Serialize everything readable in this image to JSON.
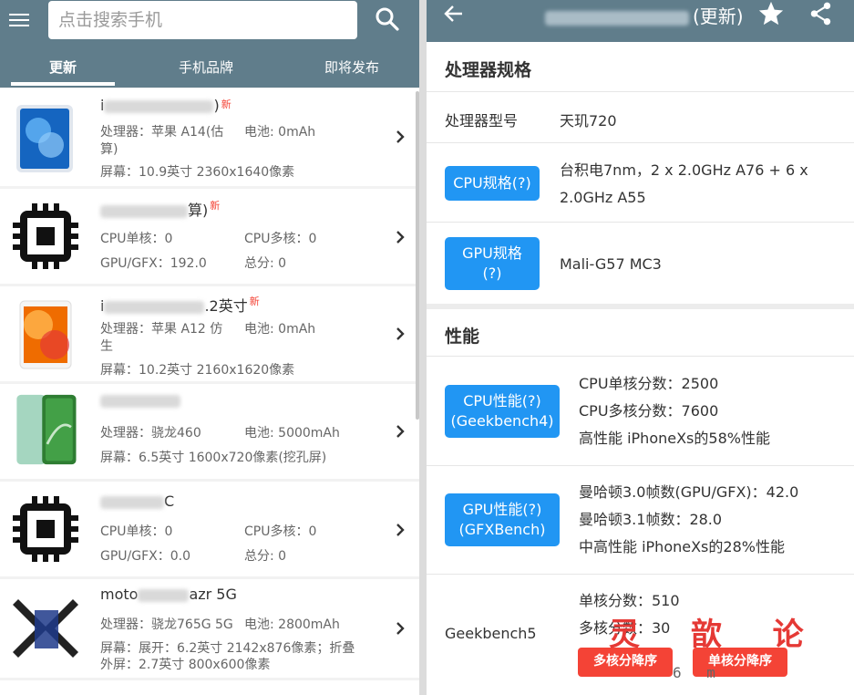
{
  "search": {
    "placeholder": "点击搜索手机"
  },
  "tabs": [
    {
      "label": "更新",
      "active": true
    },
    {
      "label": "手机品牌",
      "active": false
    },
    {
      "label": "即将发布",
      "active": false
    }
  ],
  "new_badge": "新",
  "devices": [
    {
      "name_prefix": "i",
      "name_suffix": ")",
      "new": true,
      "specs": [
        "处理器：苹果 A14(估",
        "电池: 0mAh",
        "算)",
        "屏幕：10.9英寸 2360x1640像素"
      ]
    },
    {
      "name_prefix": "",
      "name_suffix": "算)",
      "new": true,
      "specs": [
        "CPU单核：0",
        "CPU多核：0",
        "GPU/GFX：192.0",
        "总分: 0"
      ]
    },
    {
      "name_prefix": "i",
      "name_suffix": ".2英寸",
      "new": true,
      "specs": [
        "处理器：苹果 A12 仿",
        "电池: 0mAh",
        "生",
        "屏幕：10.2英寸 2160x1620像素"
      ]
    },
    {
      "name_prefix": "",
      "name_suffix": "",
      "new": false,
      "specs": [
        "处理器：骁龙460",
        "电池: 5000mAh",
        "屏幕：6.5英寸 1600x720像素(挖孔屏)"
      ]
    },
    {
      "name_prefix": "",
      "name_suffix": "C",
      "new": false,
      "specs": [
        "CPU单核：0",
        "CPU多核：0",
        "GPU/GFX：0.0",
        "总分: 0"
      ]
    },
    {
      "name_prefix": "moto",
      "name_suffix": "azr 5G",
      "new": false,
      "specs": [
        "处理器：骁龙765G 5G",
        "电池: 2800mAh",
        "屏幕：展开：6.2英寸 2142x876像素；折叠",
        "外屏：2.7英寸 800x600像素"
      ]
    }
  ],
  "detail": {
    "title_suffix": "(更新)",
    "processor_section": "处理器规格",
    "processor_model_label": "处理器型号",
    "processor_model": "天玑720",
    "cpu_spec_button": "CPU规格(?)",
    "cpu_spec_lines": [
      "台积电7nm，2 x 2.0GHz A76 + 6 x",
      "2.0GHz A55"
    ],
    "gpu_spec_button_lines": [
      "GPU规格",
      "(?)"
    ],
    "gpu_spec": "Mali-G57 MC3",
    "performance_section": "性能",
    "cpu_perf_button_lines": [
      "CPU性能(?)",
      "(Geekbench4)"
    ],
    "cpu_perf_lines": [
      "CPU单核分数：2500",
      "CPU多核分数：7600",
      "高性能   iPhoneXs的58%性能"
    ],
    "gpu_perf_button_lines": [
      "GPU性能(?)",
      "(GFXBench)"
    ],
    "gpu_perf_lines": [
      "曼哈顿3.0帧数(GPU/GFX)：42.0",
      "曼哈顿3.1帧数：28.0",
      "中高性能   iPhoneXs的28%性能"
    ],
    "gb5_label": "Geekbench5",
    "gb5_lines": [
      "单核分数：510",
      "多核分数：30"
    ],
    "sort_multi_button": "多核分降序",
    "sort_single_button": "单核分降序"
  },
  "watermark": {
    "text": "灵 歆 论 坛",
    "url": "6 m"
  },
  "colors": {
    "toolbar": "#607d8b",
    "accent_blue": "#2196f3",
    "accent_red": "#f44336"
  }
}
